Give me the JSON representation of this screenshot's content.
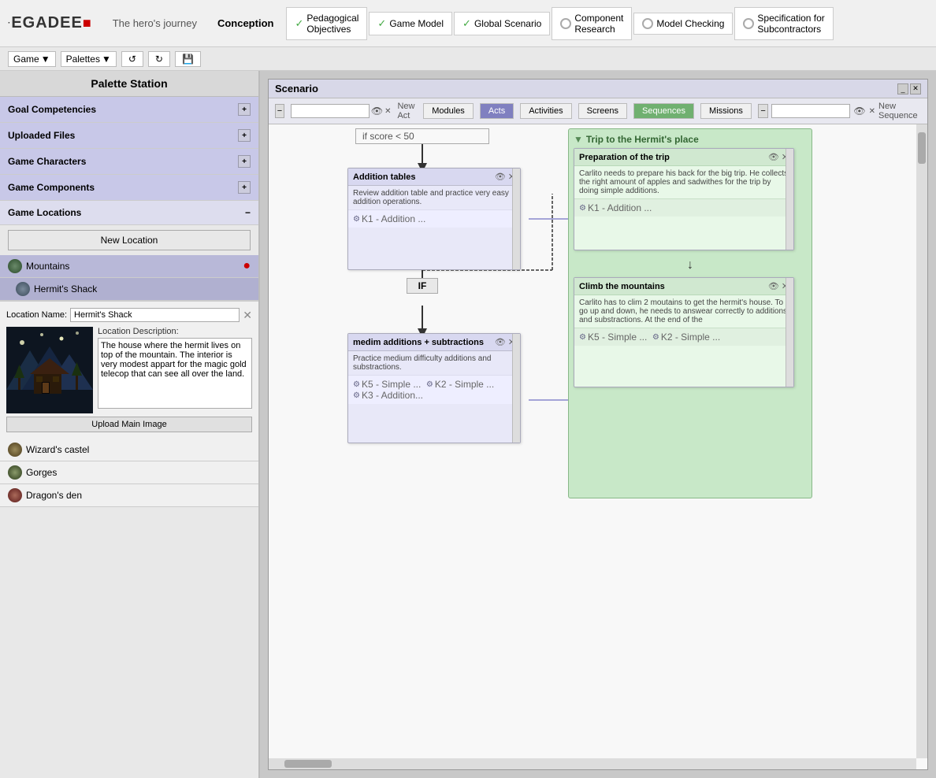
{
  "app": {
    "logo": "LEGADEE",
    "logo_dot": "■",
    "subtitle": "The hero's journey",
    "conception_label": "Conception"
  },
  "nav_steps": [
    {
      "label": "Pedagogical\nObjectives",
      "status": "check",
      "id": "ped-obj"
    },
    {
      "label": "Game Model",
      "status": "check",
      "id": "game-model"
    },
    {
      "label": "Global Scenario",
      "status": "check",
      "id": "global-scenario"
    },
    {
      "label": "Component\nResearch",
      "status": "circle",
      "id": "component-research"
    },
    {
      "label": "Model Checking",
      "status": "circle",
      "id": "model-checking"
    },
    {
      "label": "Specification for\nSubcontractors",
      "status": "circle",
      "id": "spec-sub"
    }
  ],
  "toolbar": {
    "game_label": "Game",
    "palettes_label": "Palettes"
  },
  "left_panel": {
    "title": "Palette Station",
    "sections": [
      {
        "label": "Goal Competencies",
        "id": "goal-comp"
      },
      {
        "label": "Uploaded Files",
        "id": "uploaded-files"
      },
      {
        "label": "Game Characters",
        "id": "game-chars"
      },
      {
        "label": "Game Components",
        "id": "game-comps"
      }
    ],
    "locations": {
      "header": "Game Locations",
      "new_location_btn": "New Location",
      "items": [
        {
          "name": "Mountains",
          "has_dot": true,
          "children": [
            {
              "name": "Hermit's Shack",
              "selected": true
            }
          ]
        },
        {
          "name": "Wizard's castel"
        },
        {
          "name": "Gorges"
        },
        {
          "name": "Dragon's den"
        }
      ]
    },
    "location_detail": {
      "name_label": "Location Name:",
      "name_value": "Hermit's Shack",
      "desc_label": "Location Description:",
      "desc_value": "The house where the hermit lives on top of the mountain. The interior is very modest appart for the magic gold telecop that can see all over the land.",
      "upload_btn": "Upload Main Image"
    }
  },
  "scenario": {
    "title": "Scenario",
    "tabs": [
      {
        "label": "Modules",
        "id": "modules"
      },
      {
        "label": "Acts",
        "id": "acts",
        "active": true
      },
      {
        "label": "Activities",
        "id": "activities"
      },
      {
        "label": "Screens",
        "id": "screens"
      },
      {
        "label": "Sequences",
        "id": "sequences",
        "active2": true
      },
      {
        "label": "Missions",
        "id": "missions"
      }
    ],
    "new_act_label": "New Act",
    "new_sequence_label": "New Sequence",
    "nodes": {
      "condition": "if score < 50",
      "if_label": "IF",
      "mission_group": {
        "title": "Trip to the Hermit's place"
      },
      "cards": [
        {
          "id": "card1",
          "title": "Addition tables",
          "body": "Review addition table and practice very easy addition operations.",
          "skills": [
            "K1 - Addition ..."
          ],
          "type": "activity"
        },
        {
          "id": "card2",
          "title": "medim additions + subtractions",
          "body": "Practice medium difficulty additions and substractions.",
          "skills": [
            "K5 - Simple ...",
            "K2 - Simple ...",
            "K3 - Addition..."
          ],
          "type": "activity"
        },
        {
          "id": "card3",
          "title": "Preparation of the trip",
          "body": "Carlito needs to prepare his back for the big trip. He collects the right amount of apples and sadwithes for the trip by doing simple additions.",
          "skills": [
            "K1 - Addition ..."
          ],
          "type": "prep"
        },
        {
          "id": "card4",
          "title": "Climb the mountains",
          "body": "Carlito has to clim 2 moutains to get the hermit's house. To go up and down, he needs to answear correctly to additions and substractions. At the end of the",
          "skills": [
            "K5 - Simple ...",
            "K2 - Simple ..."
          ],
          "type": "prep"
        }
      ]
    }
  }
}
